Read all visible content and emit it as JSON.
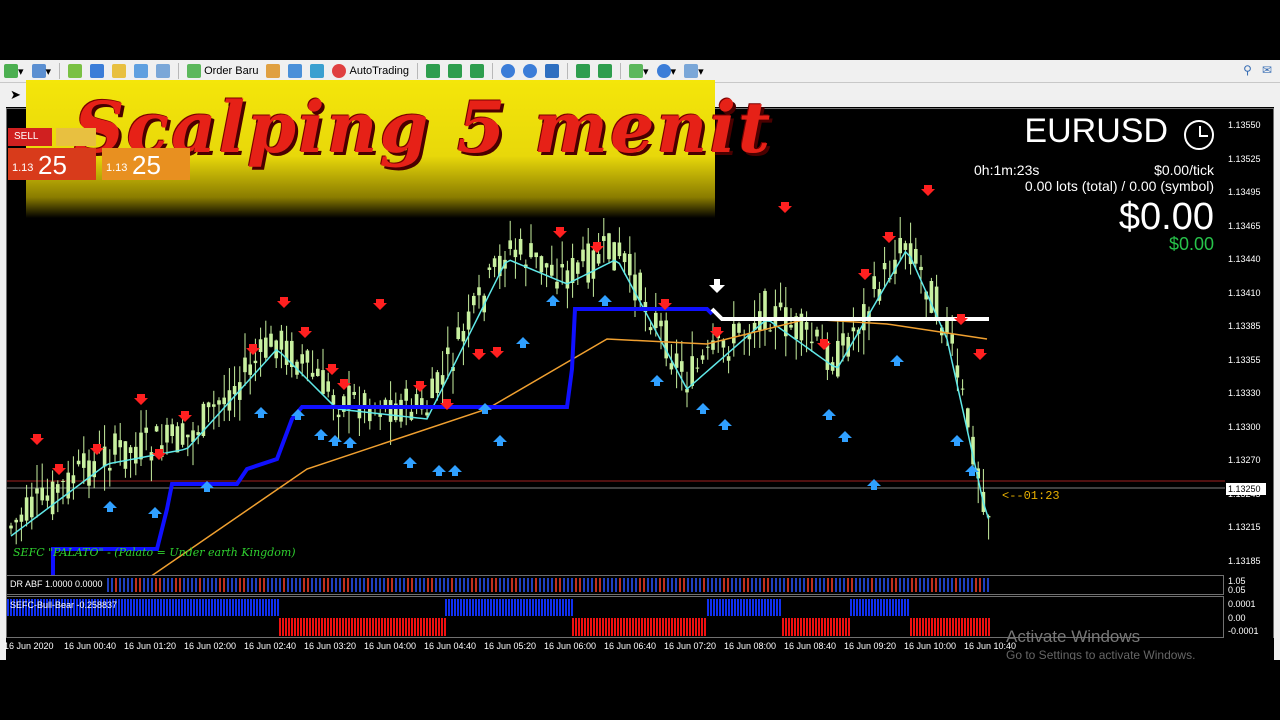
{
  "toolbar": {
    "order_label": "Order Baru",
    "autotrading_label": "AutoTrading"
  },
  "banner": {
    "title": "Scalping 5 menit"
  },
  "trade_panel": {
    "sell_label": "SELL",
    "bid_small": "1.13",
    "bid_big": "25",
    "ask_small": "1.13",
    "ask_big": "25"
  },
  "info": {
    "symbol": "EURUSD",
    "timer": "0h:1m:23s",
    "per_tick": "$0.00/tick",
    "lots": "0.00 lots (total) / 0.00 (symbol)",
    "pnl": "$0.00",
    "pnl_sub": "$0.00"
  },
  "indicator_label": "SEFC \"PALATO\" - (Palato = Under earth Kingdom)",
  "bar_timer": "<--01:23",
  "subwindow1": {
    "label": "DR ABF 1.0000 0.0000",
    "scale": [
      "1.05",
      "0.05"
    ]
  },
  "subwindow2": {
    "label": "SEFC-Bull-Bear -0.258837",
    "scale": [
      "0.0001",
      "0.00",
      "-0.0001"
    ]
  },
  "price_axis": [
    "1.13550",
    "1.13525",
    "1.13495",
    "1.13465",
    "1.13440",
    "1.13410",
    "1.13385",
    "1.13355",
    "1.13330",
    "1.13300",
    "1.13270",
    "1.13245",
    "1.13215",
    "1.13185"
  ],
  "current_price": "1.13250",
  "time_axis": [
    "16 Jun 2020",
    "16 Jun 00:40",
    "16 Jun 01:20",
    "16 Jun 02:00",
    "16 Jun 02:40",
    "16 Jun 03:20",
    "16 Jun 04:00",
    "16 Jun 04:40",
    "16 Jun 05:20",
    "16 Jun 06:00",
    "16 Jun 06:40",
    "16 Jun 07:20",
    "16 Jun 08:00",
    "16 Jun 08:40",
    "16 Jun 09:20",
    "16 Jun 10:00",
    "16 Jun 10:40"
  ],
  "watermark": {
    "line1": "Activate Windows",
    "line2": "Go to Settings to activate Windows."
  },
  "colors": {
    "up_candle": "#c8f0a0",
    "blue_line": "#1010ff",
    "cyan_ma": "#60e8e8",
    "orange_ma": "#f0a030",
    "sell_arrow": "#ff2020",
    "buy_arrow": "#30a0ff"
  }
}
